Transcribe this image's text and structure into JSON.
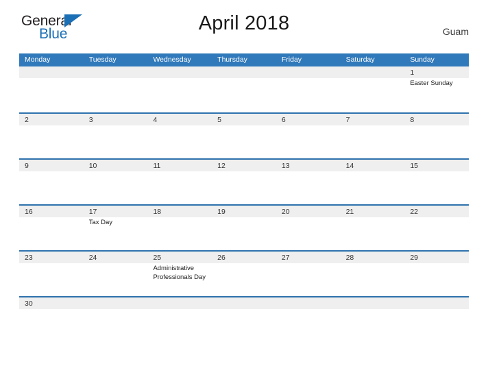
{
  "brand": {
    "name_part1": "General",
    "name_part2": "Blue",
    "triangle_icon": "triangle-icon",
    "color_dark": "#231f20",
    "color_blue": "#1b6fb5"
  },
  "header": {
    "title": "April 2018",
    "region": "Guam"
  },
  "theme": {
    "header_blue": "#3079ba",
    "rule_blue": "#2e72ad",
    "date_strip_gray": "#efefef",
    "text_dark": "#333333"
  },
  "calendar": {
    "month": "April",
    "year": "2018",
    "weekday_headers": [
      "Monday",
      "Tuesday",
      "Wednesday",
      "Thursday",
      "Friday",
      "Saturday",
      "Sunday"
    ],
    "weeks": [
      {
        "days": [
          {
            "num": "",
            "events": []
          },
          {
            "num": "",
            "events": []
          },
          {
            "num": "",
            "events": []
          },
          {
            "num": "",
            "events": []
          },
          {
            "num": "",
            "events": []
          },
          {
            "num": "",
            "events": []
          },
          {
            "num": "1",
            "events": [
              "Easter Sunday"
            ]
          }
        ]
      },
      {
        "days": [
          {
            "num": "2",
            "events": []
          },
          {
            "num": "3",
            "events": []
          },
          {
            "num": "4",
            "events": []
          },
          {
            "num": "5",
            "events": []
          },
          {
            "num": "6",
            "events": []
          },
          {
            "num": "7",
            "events": []
          },
          {
            "num": "8",
            "events": []
          }
        ]
      },
      {
        "days": [
          {
            "num": "9",
            "events": []
          },
          {
            "num": "10",
            "events": []
          },
          {
            "num": "11",
            "events": []
          },
          {
            "num": "12",
            "events": []
          },
          {
            "num": "13",
            "events": []
          },
          {
            "num": "14",
            "events": []
          },
          {
            "num": "15",
            "events": []
          }
        ]
      },
      {
        "days": [
          {
            "num": "16",
            "events": []
          },
          {
            "num": "17",
            "events": [
              "Tax Day"
            ]
          },
          {
            "num": "18",
            "events": []
          },
          {
            "num": "19",
            "events": []
          },
          {
            "num": "20",
            "events": []
          },
          {
            "num": "21",
            "events": []
          },
          {
            "num": "22",
            "events": []
          }
        ]
      },
      {
        "days": [
          {
            "num": "23",
            "events": []
          },
          {
            "num": "24",
            "events": []
          },
          {
            "num": "25",
            "events": [
              "Administrative Professionals Day"
            ]
          },
          {
            "num": "26",
            "events": []
          },
          {
            "num": "27",
            "events": []
          },
          {
            "num": "28",
            "events": []
          },
          {
            "num": "29",
            "events": []
          }
        ]
      },
      {
        "last": true,
        "days": [
          {
            "num": "30",
            "events": []
          },
          {
            "num": "",
            "events": []
          },
          {
            "num": "",
            "events": []
          },
          {
            "num": "",
            "events": []
          },
          {
            "num": "",
            "events": []
          },
          {
            "num": "",
            "events": []
          },
          {
            "num": "",
            "events": []
          }
        ]
      }
    ]
  }
}
